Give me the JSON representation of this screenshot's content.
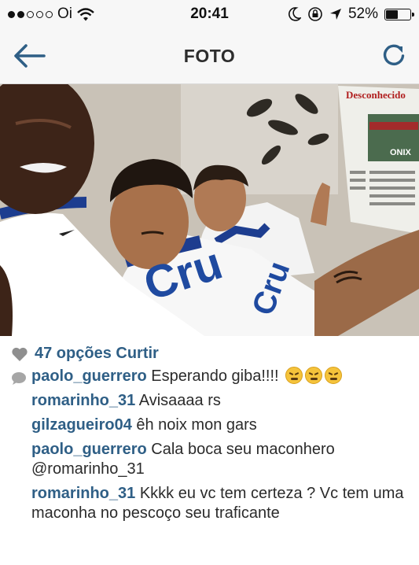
{
  "status": {
    "carrier": "Oi",
    "time": "20:41",
    "battery": "52%",
    "battery_level": 0.52
  },
  "nav": {
    "title": "FOTO",
    "back_icon": "arrow-left-icon",
    "refresh_icon": "refresh-icon"
  },
  "photo": {
    "newspaper_header": "Desconhecido",
    "newspaper_sponsor": "ONIX",
    "shirt_sponsor": "Cru"
  },
  "likes": {
    "text": "47 opções Curtir"
  },
  "comments": [
    {
      "user": "paolo_guerrero",
      "text": "Esperando giba!!!!",
      "emojis": 3
    },
    {
      "user": "romarinho_31",
      "text": "Avisaaaa rs"
    },
    {
      "user": "gilzagueiro04",
      "text": "êh noix mon gars"
    },
    {
      "user": "paolo_guerrero",
      "text": "Cala boca seu maconhero @romarinho_31"
    },
    {
      "user": "romarinho_31",
      "text": "Kkkk eu vc tem certeza ? Vc tem uma maconha no pescoço seu traficante"
    }
  ],
  "colors": {
    "accent": "#2f5f86",
    "bar_bg": "#f7f7f7"
  }
}
